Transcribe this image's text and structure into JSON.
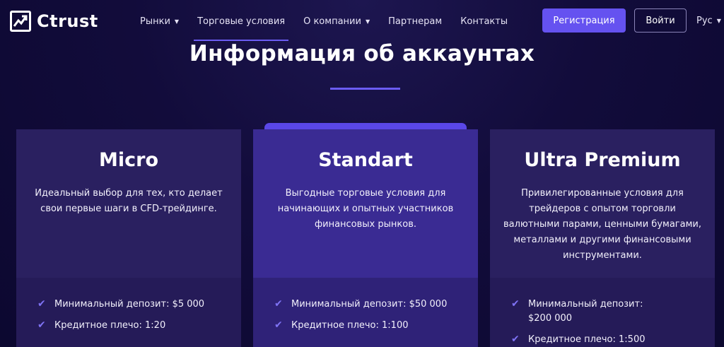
{
  "header": {
    "logo_text": "Ctrust",
    "nav": [
      {
        "label": "Рынки",
        "dropdown": true,
        "active": false
      },
      {
        "label": "Торговые условия",
        "dropdown": false,
        "active": true
      },
      {
        "label": "О компании",
        "dropdown": true,
        "active": false
      },
      {
        "label": "Партнерам",
        "dropdown": false,
        "active": false
      },
      {
        "label": "Контакты",
        "dropdown": false,
        "active": false
      }
    ],
    "register_label": "Регистрация",
    "login_label": "Войти",
    "language": "Рус"
  },
  "section": {
    "title": "Информация об аккаунтах"
  },
  "cards": [
    {
      "name": "Micro",
      "description": "Идеальный выбор для тех, кто делает свои первые шаги в CFD-трейдинге.",
      "features": [
        "Минимальный депозит: $5 000",
        "Кредитное плечо: 1:20"
      ]
    },
    {
      "name": "Standart",
      "description": "Выгодные торговые условия для начинающих и опытных участников финансовых рынков.",
      "features": [
        "Минимальный депозит: $50 000",
        "Кредитное плечо: 1:100"
      ]
    },
    {
      "name": "Ultra Premium",
      "description": "Привилегированные условия для трейдеров с опытом торговли валютными парами, ценными бумагами, металлами и другими финансовыми инструментами.",
      "features": [
        "Минимальный депозит: $200 000",
        "Кредитное плечо: 1:500"
      ]
    }
  ],
  "colors": {
    "accent": "#6552f0",
    "background": "#120c3b",
    "card": "#2a2060",
    "card_featured": "#3a2b93"
  },
  "icons": {
    "logo": "chart-line-icon",
    "check": "check-icon",
    "caret": "chevron-down-icon"
  }
}
